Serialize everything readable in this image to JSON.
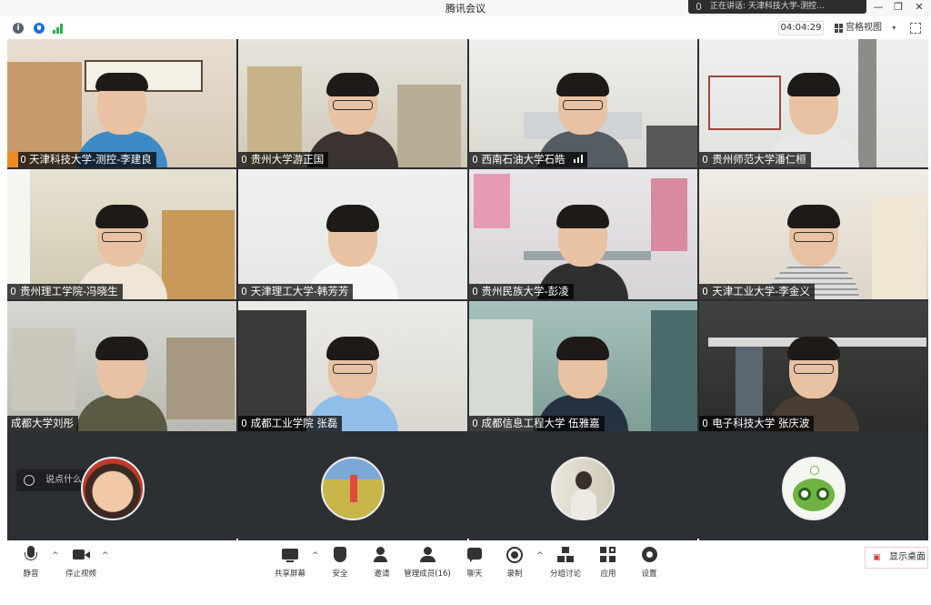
{
  "window": {
    "title": "腾讯会议",
    "speaking_text": "正在讲话: 天津科技大学-测控..."
  },
  "infobar": {
    "timer": "04:04:29",
    "view_mode": "宫格视图"
  },
  "participants": [
    {
      "name": "天津科技大学-测控-李建良"
    },
    {
      "name": "贵州大学游正国"
    },
    {
      "name": "西南石油大学石皓"
    },
    {
      "name": "贵州师范大学潘仁桓"
    },
    {
      "name": "贵州理工学院-冯晓生"
    },
    {
      "name": "天津理工大学-韩芳芳"
    },
    {
      "name": "贵州民族大学-彭凌"
    },
    {
      "name": "天津工业大学-李金义"
    },
    {
      "name": "成都大学刘彤"
    },
    {
      "name": "成都工业学院 张磊"
    },
    {
      "name": "成都信息工程大学 伍雅嘉"
    },
    {
      "name": "电子科技大学 张庆波"
    }
  ],
  "chat": {
    "placeholder": "说点什么..."
  },
  "toolbar": {
    "mute": "静音",
    "stop_video": "停止视频",
    "share_screen": "共享屏幕",
    "security": "安全",
    "invite": "邀请",
    "manage_members": "管理成员(16)",
    "chat": "聊天",
    "record": "录制",
    "breakout": "分组讨论",
    "apps": "应用",
    "settings": "设置",
    "show_desktop": "显示桌面"
  }
}
